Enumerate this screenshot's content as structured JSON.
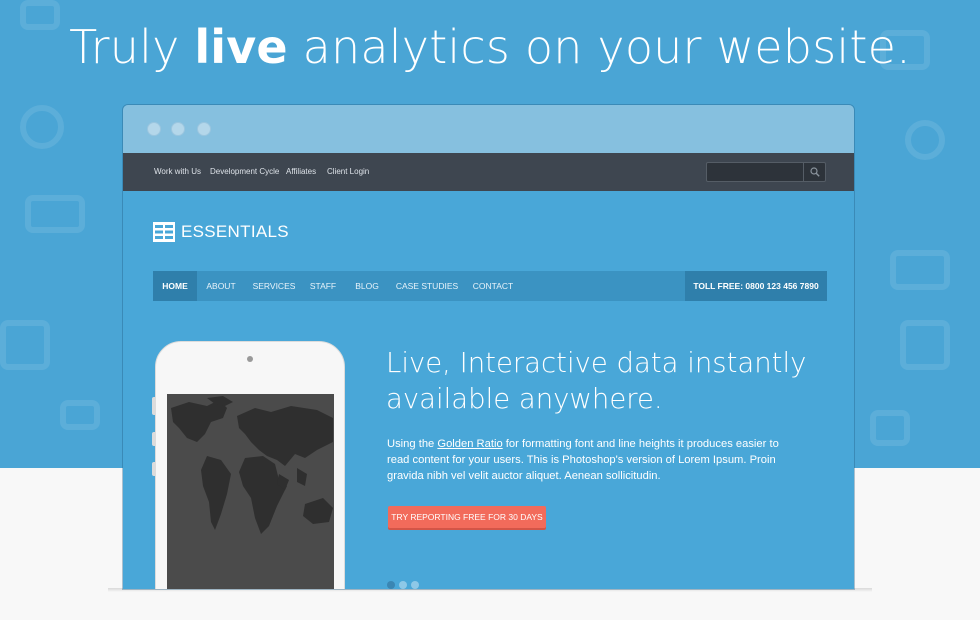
{
  "headline": {
    "pre": "Truly ",
    "bold": "live",
    "post": " analytics on your website."
  },
  "colors": {
    "hero_bg": "#4aa5d5",
    "site_bg": "#49a7d8",
    "topbar": "#3e4650",
    "nav": "#3b93c2",
    "nav_active": "#2f7fab",
    "cta": "#f26b5b"
  },
  "topbar": {
    "links": [
      "Work with Us",
      "Development Cycle",
      "Affiliates",
      "Client Login"
    ],
    "search_icon": "magnifier-icon"
  },
  "logo": {
    "icon": "grid-logo-icon",
    "text": "ESSENTIALS"
  },
  "nav": {
    "items": [
      "HOME",
      "ABOUT",
      "SERVICES",
      "STAFF",
      "BLOG",
      "CASE STUDIES",
      "CONTACT"
    ],
    "active": "HOME",
    "tollfree": "TOLL FREE: 0800 123 456 7890"
  },
  "hero": {
    "title_line1": "Live, Interactive data instantly",
    "title_line2": "available anywhere.",
    "body_pre": "Using the ",
    "body_link": "Golden Ratio",
    "body_post": " for formatting font and line heights it produces easier to read content for your users. This is Photoshop's version  of Lorem Ipsum. Proin gravida nibh vel velit auctor aliquet. Aenean sollicitudin.",
    "cta": "TRY REPORTING FREE FOR 30 DAYS"
  },
  "slider": {
    "count": 3,
    "active_index": 0
  }
}
